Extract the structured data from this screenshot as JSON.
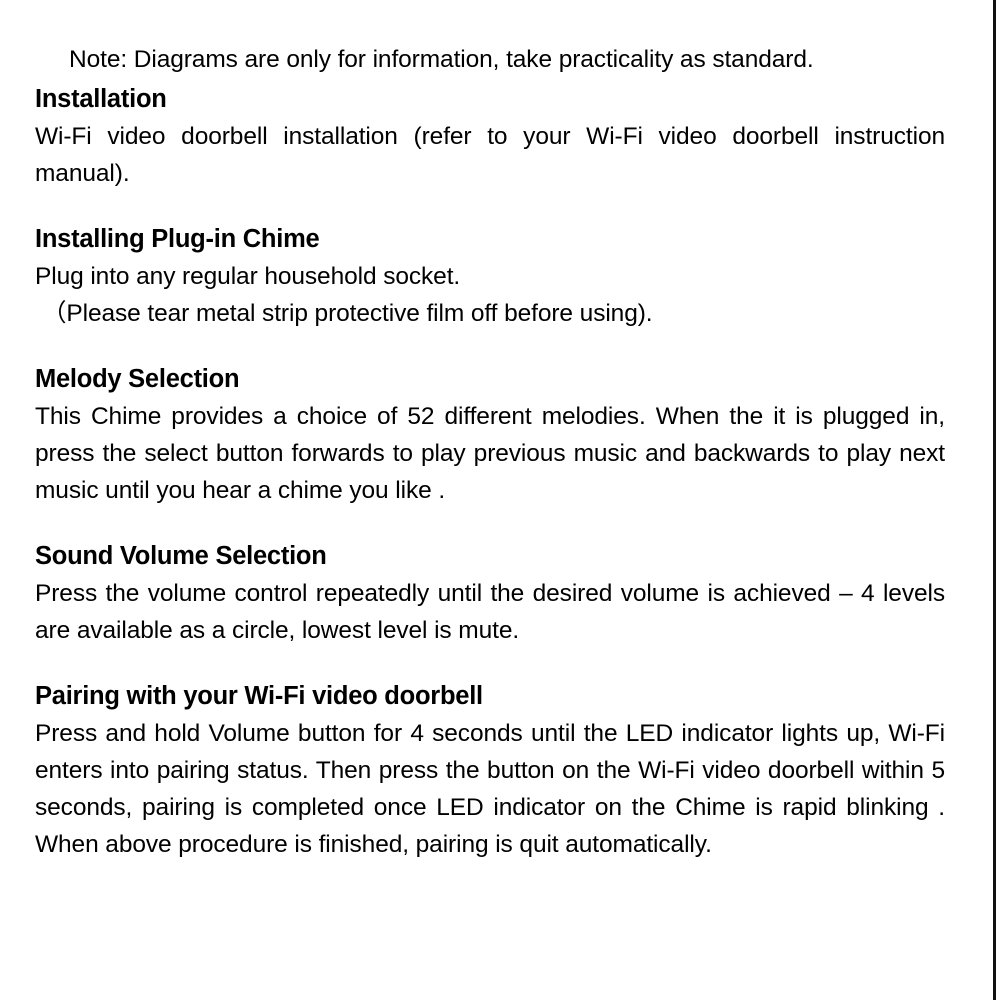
{
  "document": {
    "note": "Note: Diagrams are only for information, take practicality as standard.",
    "sections": [
      {
        "heading": "Installation",
        "paragraphs": [
          "Wi-Fi video doorbell installation (refer to your Wi-Fi video doorbell instruction manual)."
        ]
      },
      {
        "heading": "Installing Plug-in Chime",
        "paragraphs": [
          "Plug into any regular household socket.",
          "（Please tear metal strip protective film off before using)."
        ]
      },
      {
        "heading": "Melody Selection",
        "paragraphs": [
          "This Chime provides a choice of 52 different melodies. When the it is plugged in, press the select button forwards to play previous music and backwards to play next music until you hear a chime you like ."
        ]
      },
      {
        "heading": "Sound Volume Selection",
        "paragraphs": [
          "Press the volume control repeatedly until the desired volume is achieved – 4 levels are available as a circle, lowest level is mute."
        ]
      },
      {
        "heading": "Pairing with your Wi-Fi video doorbell",
        "paragraphs": [
          "Press and hold Volume button for 4 seconds until the LED indicator lights up, Wi-Fi enters into pairing status. Then press the button on the Wi-Fi video doorbell within 5 seconds, pairing is completed once LED indicator on the Chime is rapid blinking . When above procedure is finished, pairing is quit automatically."
        ]
      }
    ]
  },
  "colors": {
    "page_background": "#ffffff",
    "text": "#000000",
    "edge_rule": "#111111"
  }
}
